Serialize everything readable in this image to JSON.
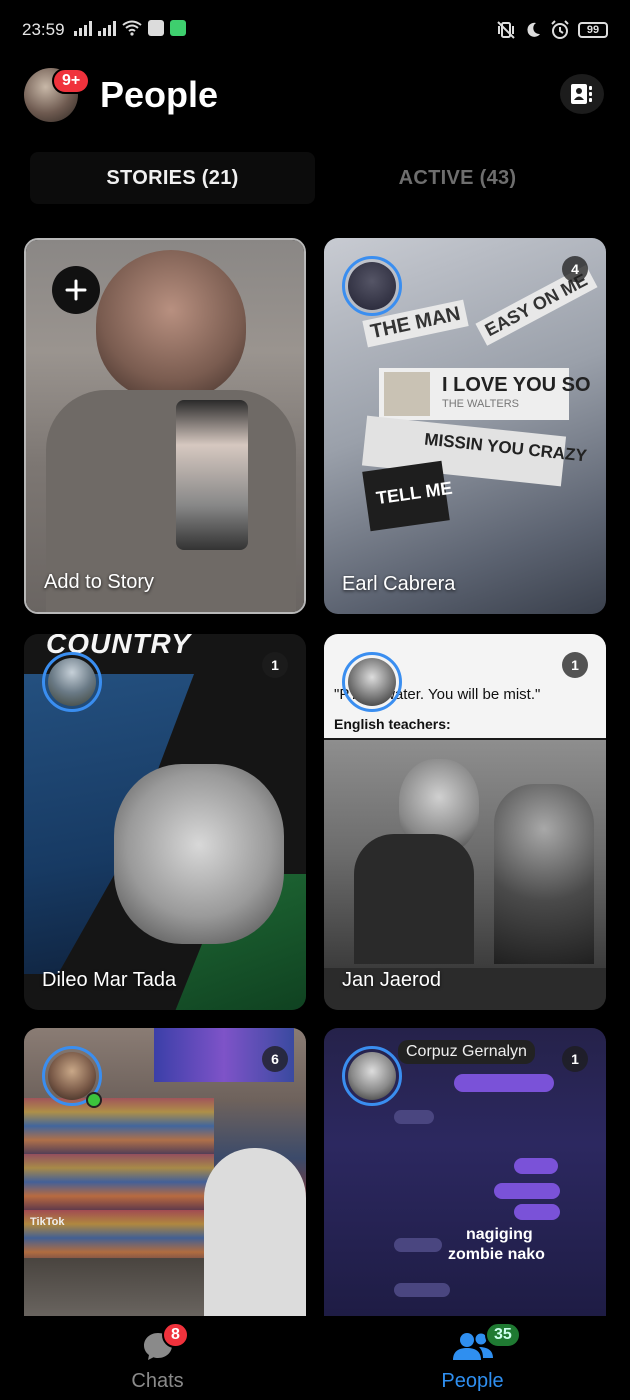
{
  "status_bar": {
    "time": "23:59",
    "battery": "99"
  },
  "header": {
    "title": "People",
    "notification_badge": "9+"
  },
  "tabs": [
    {
      "label": "STORIES (21)",
      "active": true
    },
    {
      "label": "ACTIVE (43)",
      "active": false
    }
  ],
  "stories": [
    {
      "name": "Add to Story",
      "count": "",
      "own": true
    },
    {
      "name": "Earl Cabrera",
      "count": "4"
    },
    {
      "name": "Dileo Mar Tada",
      "count": "1"
    },
    {
      "name": "Jan Jaerod",
      "count": "1"
    },
    {
      "name": "",
      "count": "6",
      "online": true
    },
    {
      "name": "",
      "count": "1"
    }
  ],
  "story_overlays": {
    "earl": [
      "THE MAN",
      "EASY ON ME",
      "I LOVE YOU SO",
      "THE WALTERS",
      "MISSIN YOU CRAZY",
      "TELL ME"
    ],
    "dileo": "COUNTRY",
    "jan_caption": "\"P...led water. You will be mist.\"",
    "jan_sub": "English teachers:",
    "card5_watermark": "TikTok",
    "card6_header": "Corpuz Gernalyn",
    "card6_text": [
      "nagiging",
      "zombie nako"
    ]
  },
  "bottom_nav": {
    "chats_label": "Chats",
    "chats_badge": "8",
    "people_label": "People",
    "people_badge": "35"
  },
  "colors": {
    "accent": "#2f8ff0",
    "badge_red": "#f0323c",
    "badge_green": "#1f7a32",
    "background": "#000000"
  }
}
